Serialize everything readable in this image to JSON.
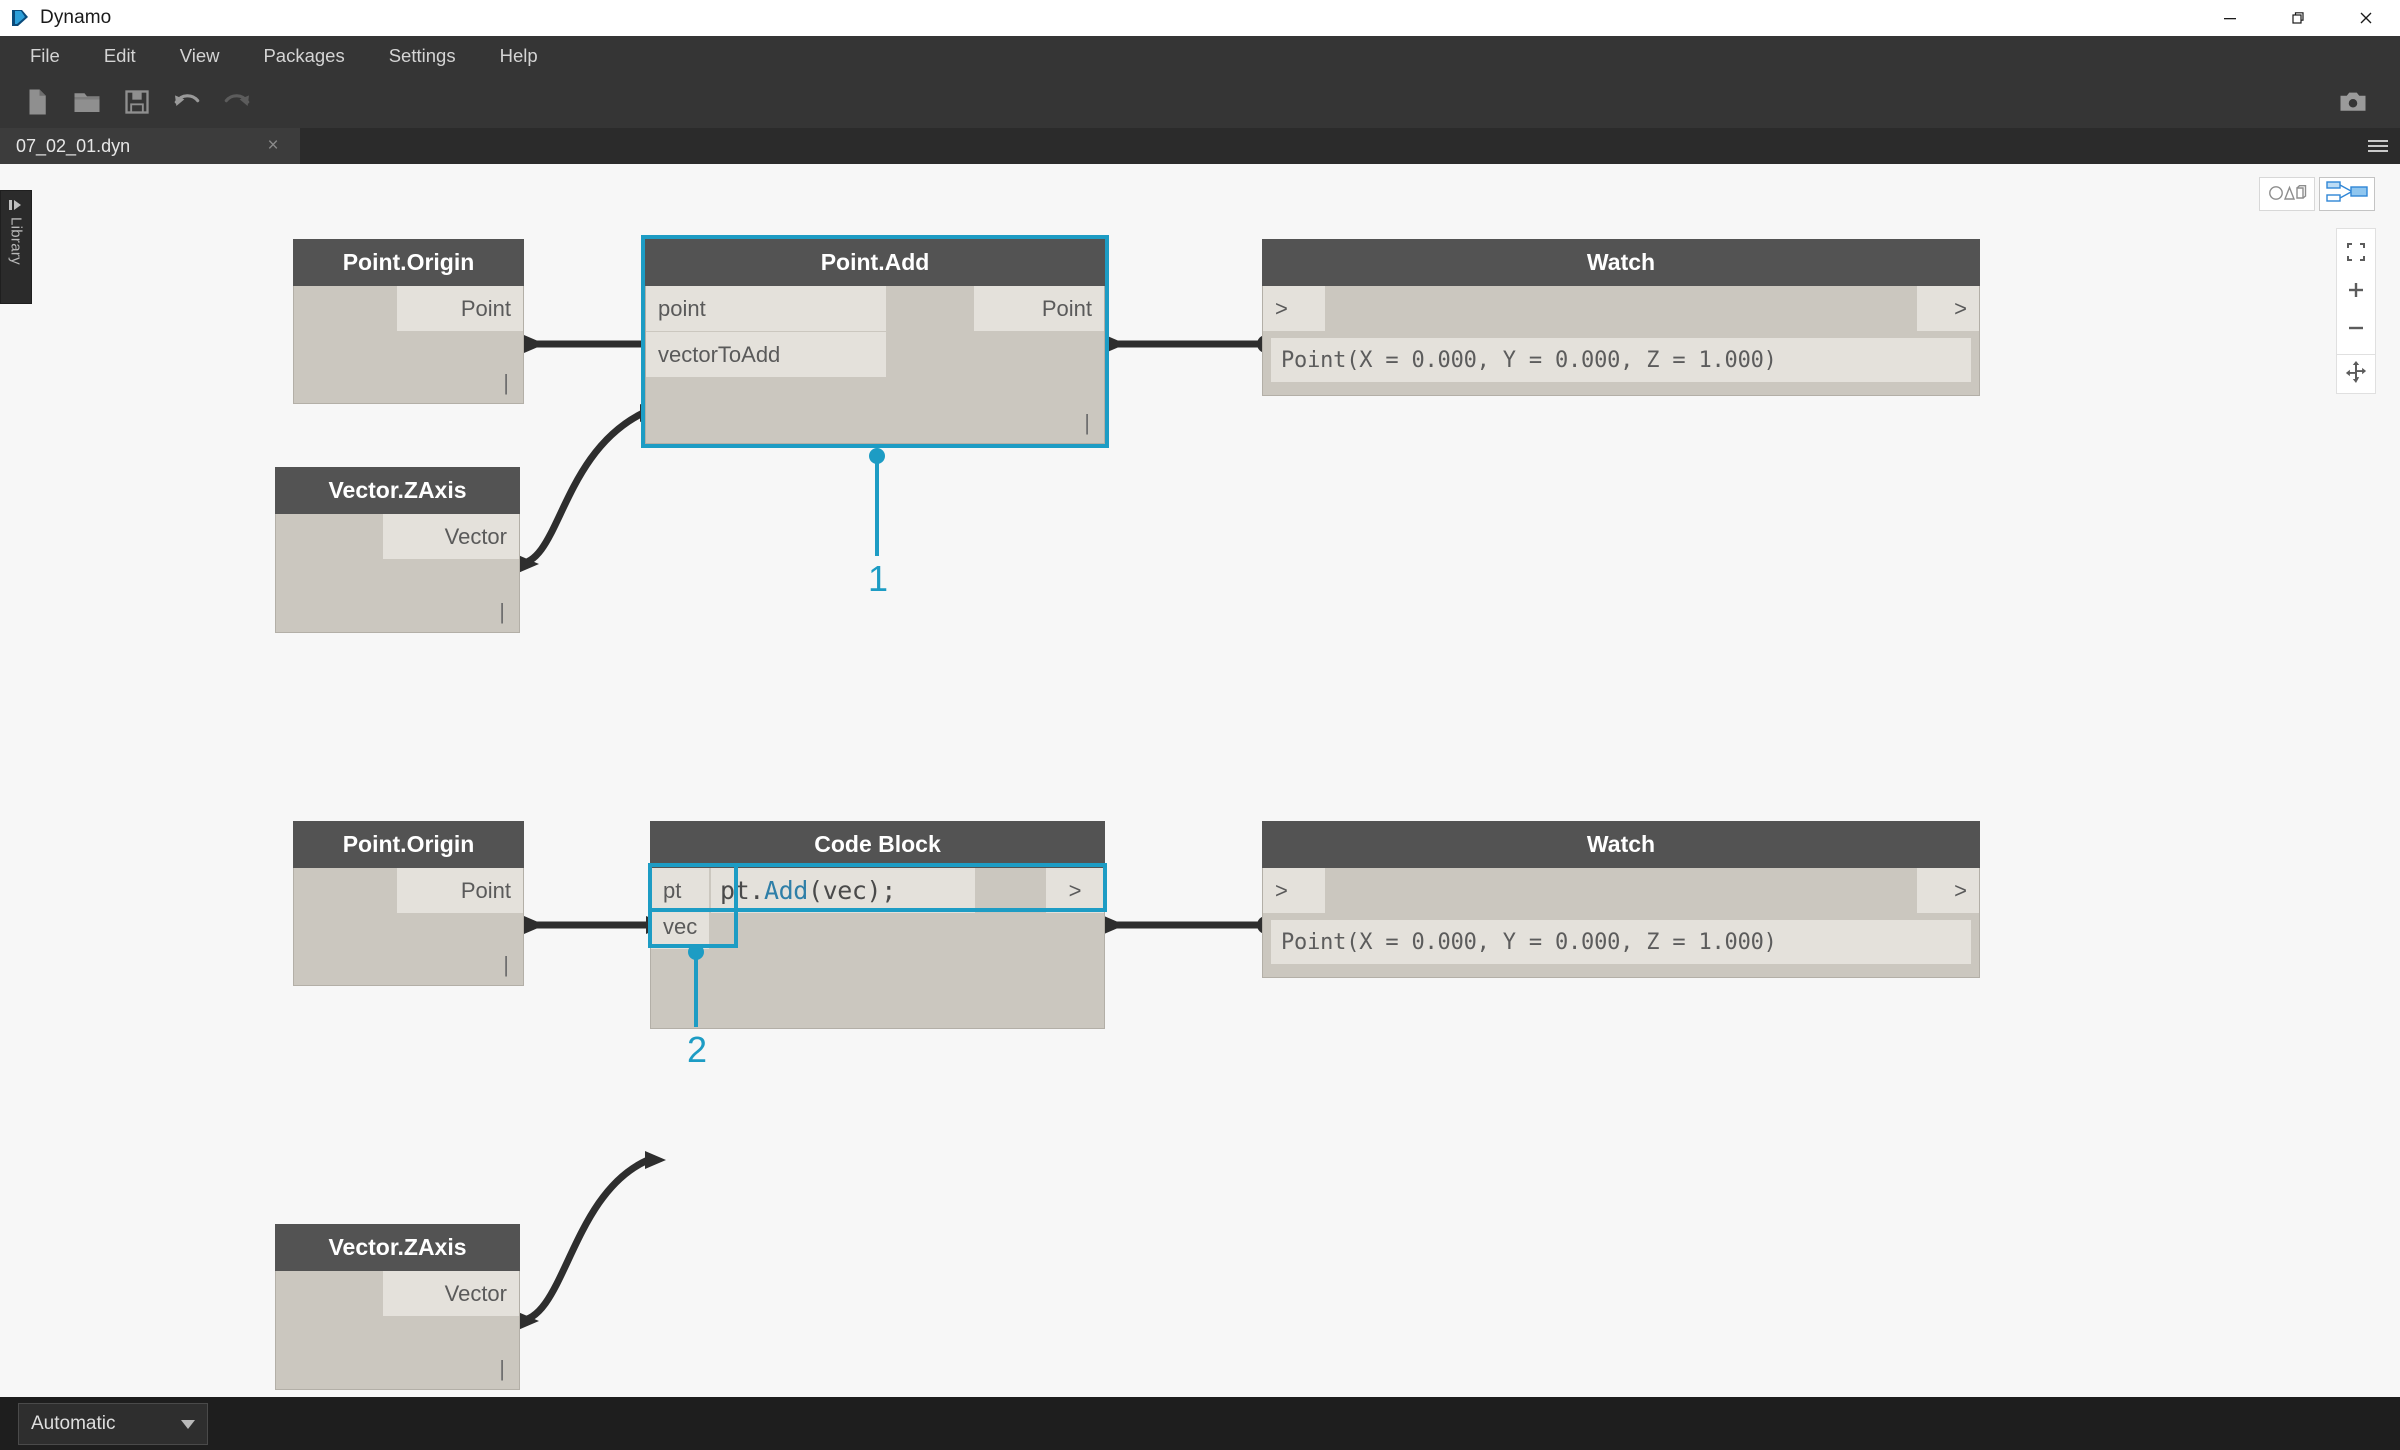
{
  "window": {
    "app_title": "Dynamo",
    "logo_icon": "dynamo-logo-icon",
    "controls": [
      {
        "name": "minimize-button",
        "icon": "minimize-icon"
      },
      {
        "name": "restore-button",
        "icon": "restore-icon"
      },
      {
        "name": "close-button",
        "icon": "close-icon"
      }
    ]
  },
  "menubar": {
    "items": [
      {
        "label": "File"
      },
      {
        "label": "Edit"
      },
      {
        "label": "View"
      },
      {
        "label": "Packages"
      },
      {
        "label": "Settings"
      },
      {
        "label": "Help"
      }
    ]
  },
  "toolbar": {
    "buttons": [
      {
        "name": "new-file-button",
        "icon": "new-file-icon"
      },
      {
        "name": "open-file-button",
        "icon": "open-folder-icon"
      },
      {
        "name": "save-file-button",
        "icon": "save-disk-icon"
      },
      {
        "name": "undo-button",
        "icon": "undo-arrow-icon"
      },
      {
        "name": "redo-button",
        "icon": "redo-arrow-icon"
      }
    ],
    "screenshot_button": {
      "name": "screenshot-button",
      "icon": "camera-icon"
    }
  },
  "tabbar": {
    "tabs": [
      {
        "label": "07_02_01.dyn",
        "close_label": "×"
      }
    ],
    "menu_icon": "hamburger-menu-icon"
  },
  "sidebar": {
    "library_label": "Library",
    "expand_icon": "expand-panel-icon"
  },
  "canvas_controls": {
    "view_toggles": [
      {
        "name": "3d-preview-toggle",
        "icon": "geometry-shapes-icon",
        "active": false
      },
      {
        "name": "graph-view-toggle",
        "icon": "node-graph-icon",
        "active": true
      }
    ],
    "zoom_buttons": [
      {
        "name": "zoom-to-fit-button",
        "icon": "fit-to-screen-icon"
      },
      {
        "name": "zoom-in-button",
        "icon": "plus-icon"
      },
      {
        "name": "zoom-out-button",
        "icon": "minus-icon"
      }
    ],
    "pan_button": {
      "name": "pan-button",
      "icon": "pan-move-icon"
    }
  },
  "graph": {
    "accent_color": "#1d9cc4",
    "node_header_color": "#535353",
    "node_body_color": "#cbc7bf",
    "port_color": "#e4e1db",
    "wire_color": "#2e2e2e",
    "nodes": [
      {
        "id": "point-origin-1",
        "title": "Point.Origin",
        "outputs": [
          "Point"
        ],
        "inputs": [],
        "lacing": "|",
        "selected": false
      },
      {
        "id": "vector-zaxis-1",
        "title": "Vector.ZAxis",
        "outputs": [
          "Vector"
        ],
        "inputs": [],
        "lacing": "|",
        "selected": false
      },
      {
        "id": "point-add-1",
        "title": "Point.Add",
        "inputs": [
          "point",
          "vectorToAdd"
        ],
        "outputs": [
          "Point"
        ],
        "lacing": "|",
        "selected": true
      },
      {
        "id": "watch-1",
        "title": "Watch",
        "inputs": [
          ">"
        ],
        "outputs": [
          ">"
        ],
        "result": "Point(X = 0.000, Y = 0.000, Z = 1.000)",
        "selected": false
      },
      {
        "id": "point-origin-2",
        "title": "Point.Origin",
        "outputs": [
          "Point"
        ],
        "inputs": [],
        "lacing": "|",
        "selected": false
      },
      {
        "id": "vector-zaxis-2",
        "title": "Vector.ZAxis",
        "outputs": [
          "Vector"
        ],
        "inputs": [],
        "lacing": "|",
        "selected": false
      },
      {
        "id": "code-block-1",
        "title": "Code Block",
        "inputs": [
          "pt",
          "vec"
        ],
        "outputs": [
          ">"
        ],
        "code_prefix": "pt.",
        "code_fn": "Add",
        "code_suffix": "(vec);",
        "code_full": "pt.Add(vec);",
        "selected": false
      },
      {
        "id": "watch-2",
        "title": "Watch",
        "inputs": [
          ">"
        ],
        "outputs": [
          ">"
        ],
        "result": "Point(X = 0.000, Y = 0.000, Z = 1.000)",
        "selected": false
      }
    ],
    "callouts": [
      {
        "label": "1",
        "target": "point-add-1"
      },
      {
        "label": "2",
        "target": "code-block-1"
      }
    ]
  },
  "statusbar": {
    "run_mode": "Automatic",
    "caret_icon": "chevron-down-icon"
  }
}
